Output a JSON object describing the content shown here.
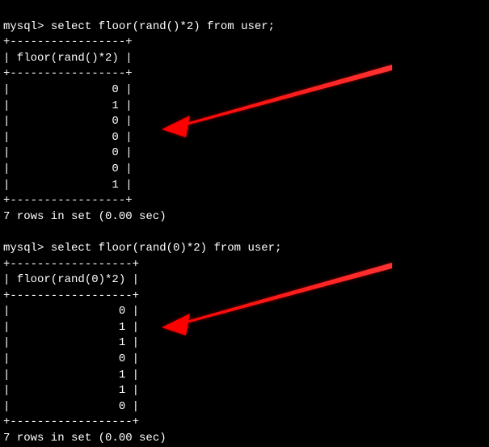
{
  "query1": {
    "prompt": "mysql>",
    "command": "select floor(rand()*2) from user;",
    "divider_top": "+-----------------+",
    "header_line": "| floor(rand()*2) |",
    "divider_mid": "+-----------------+",
    "rows": [
      "|               0 |",
      "|               1 |",
      "|               0 |",
      "|               0 |",
      "|               0 |",
      "|               0 |",
      "|               1 |"
    ],
    "divider_bottom": "+-----------------+",
    "result": "7 rows in set (0.00 sec)"
  },
  "query2": {
    "prompt": "mysql>",
    "command": "select floor(rand(0)*2) from user;",
    "divider_top": "+------------------+",
    "header_line": "| floor(rand(0)*2) |",
    "divider_mid": "+------------------+",
    "rows": [
      "|                0 |",
      "|                1 |",
      "|                1 |",
      "|                0 |",
      "|                1 |",
      "|                1 |",
      "|                0 |"
    ],
    "divider_bottom": "+------------------+",
    "result": "7 rows in set (0.00 sec)"
  }
}
